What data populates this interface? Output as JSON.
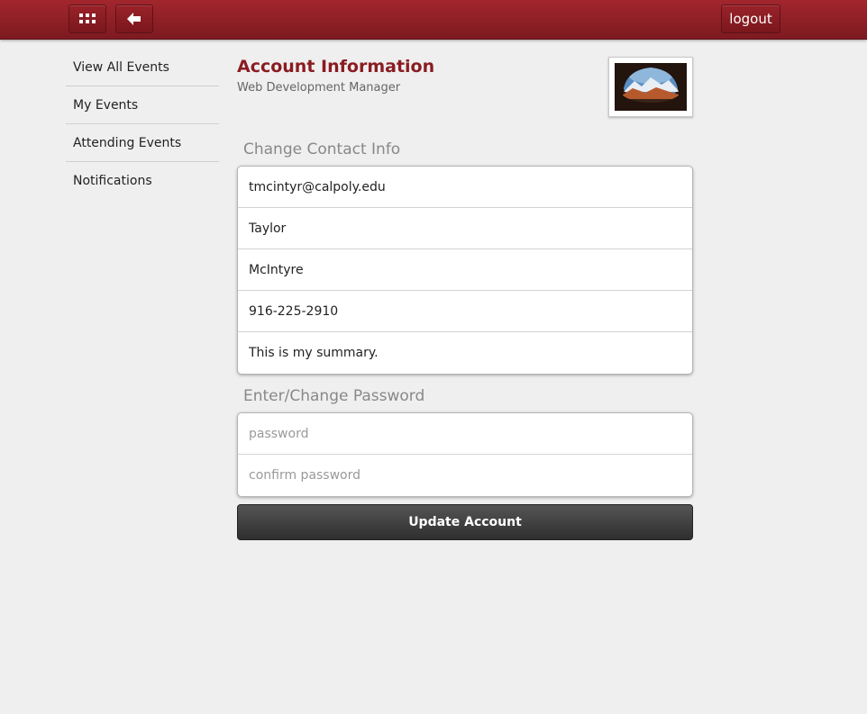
{
  "topbar": {
    "menu_icon": "apps-grid-icon",
    "back_icon": "arrow-left-icon",
    "logout_label": "logout",
    "bar_color": "#8e1f25"
  },
  "sidebar": {
    "items": [
      {
        "label": "View All Events"
      },
      {
        "label": "My Events"
      },
      {
        "label": "Attending Events"
      },
      {
        "label": "Notifications"
      }
    ]
  },
  "main": {
    "title": "Account Information",
    "subtitle": "Web Development Manager",
    "title_color": "#8a1c22"
  },
  "contact": {
    "section_label": "Change Contact Info",
    "email": "tmcintyr@calpoly.edu",
    "first_name": "Taylor",
    "last_name": "McIntyre",
    "phone": "916-225-2910",
    "summary": "This is my summary."
  },
  "password": {
    "section_label": "Enter/Change Password",
    "password_placeholder": "password",
    "confirm_placeholder": "confirm password"
  },
  "actions": {
    "update_label": "Update Account"
  }
}
